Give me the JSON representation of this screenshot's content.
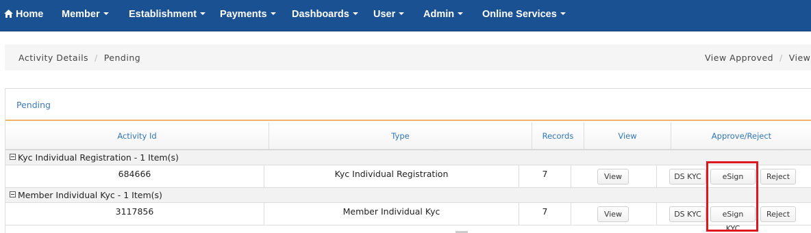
{
  "nav": {
    "home": "Home",
    "items": [
      "Member",
      "Establishment",
      "Payments",
      "Dashboards",
      "User",
      "Admin",
      "Online Services"
    ],
    "bg_color": "#1a5192"
  },
  "breadcrumb": {
    "items": [
      "Activity Details",
      "Pending"
    ],
    "right_items": [
      "View Approved",
      "View"
    ]
  },
  "panel": {
    "title": "Pending",
    "accent_color": "#f0b56a"
  },
  "table": {
    "columns": [
      "Activity Id",
      "Type",
      "Records",
      "View",
      "Approve/Reject"
    ],
    "groups": [
      {
        "label": "Kyc Individual Registration - 1 Item(s)",
        "rows": [
          {
            "activity_id": "684666",
            "type": "Kyc Individual Registration",
            "records": "7",
            "view_label": "View",
            "buttons": [
              "DS KYC",
              "eSign KYC",
              "Reject"
            ]
          }
        ]
      },
      {
        "label": "Member Individual Kyc - 1 Item(s)",
        "rows": [
          {
            "activity_id": "3117856",
            "type": "Member Individual Kyc",
            "records": "7",
            "view_label": "View",
            "buttons": [
              "DS KYC",
              "eSign KYC",
              "Reject"
            ]
          }
        ]
      }
    ]
  },
  "highlight_color": "#e0161e"
}
